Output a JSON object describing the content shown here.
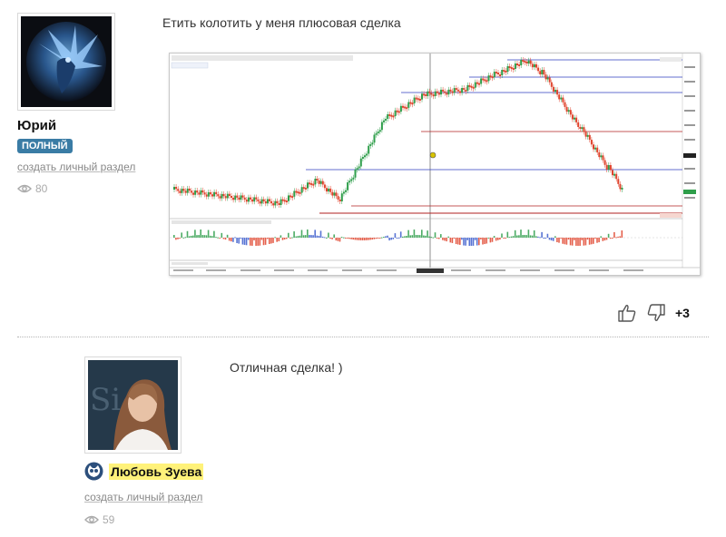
{
  "post1": {
    "username": "Юрий",
    "badge": "ПОЛНЫЙ",
    "create_section_link": "создать личный раздел",
    "views": "80",
    "comment": "Етить колотить у меня плюсовая сделка",
    "score": "+3",
    "avatar_icon": "dragon-image"
  },
  "post2": {
    "username": "Любовь Зуева",
    "create_section_link": "создать личный раздел",
    "views": "59",
    "comment": "Отличная сделка! )",
    "avatar_icon": "woman-portrait-image",
    "name_icon": "owl-icon"
  },
  "colors": {
    "badge": "#3a7ca5",
    "name_highlight": "#fff27a",
    "bull_candle": "#2e9e4a",
    "bear_candle": "#e0442d",
    "level_blue": "#2f3fbf",
    "level_red": "#b22222"
  }
}
